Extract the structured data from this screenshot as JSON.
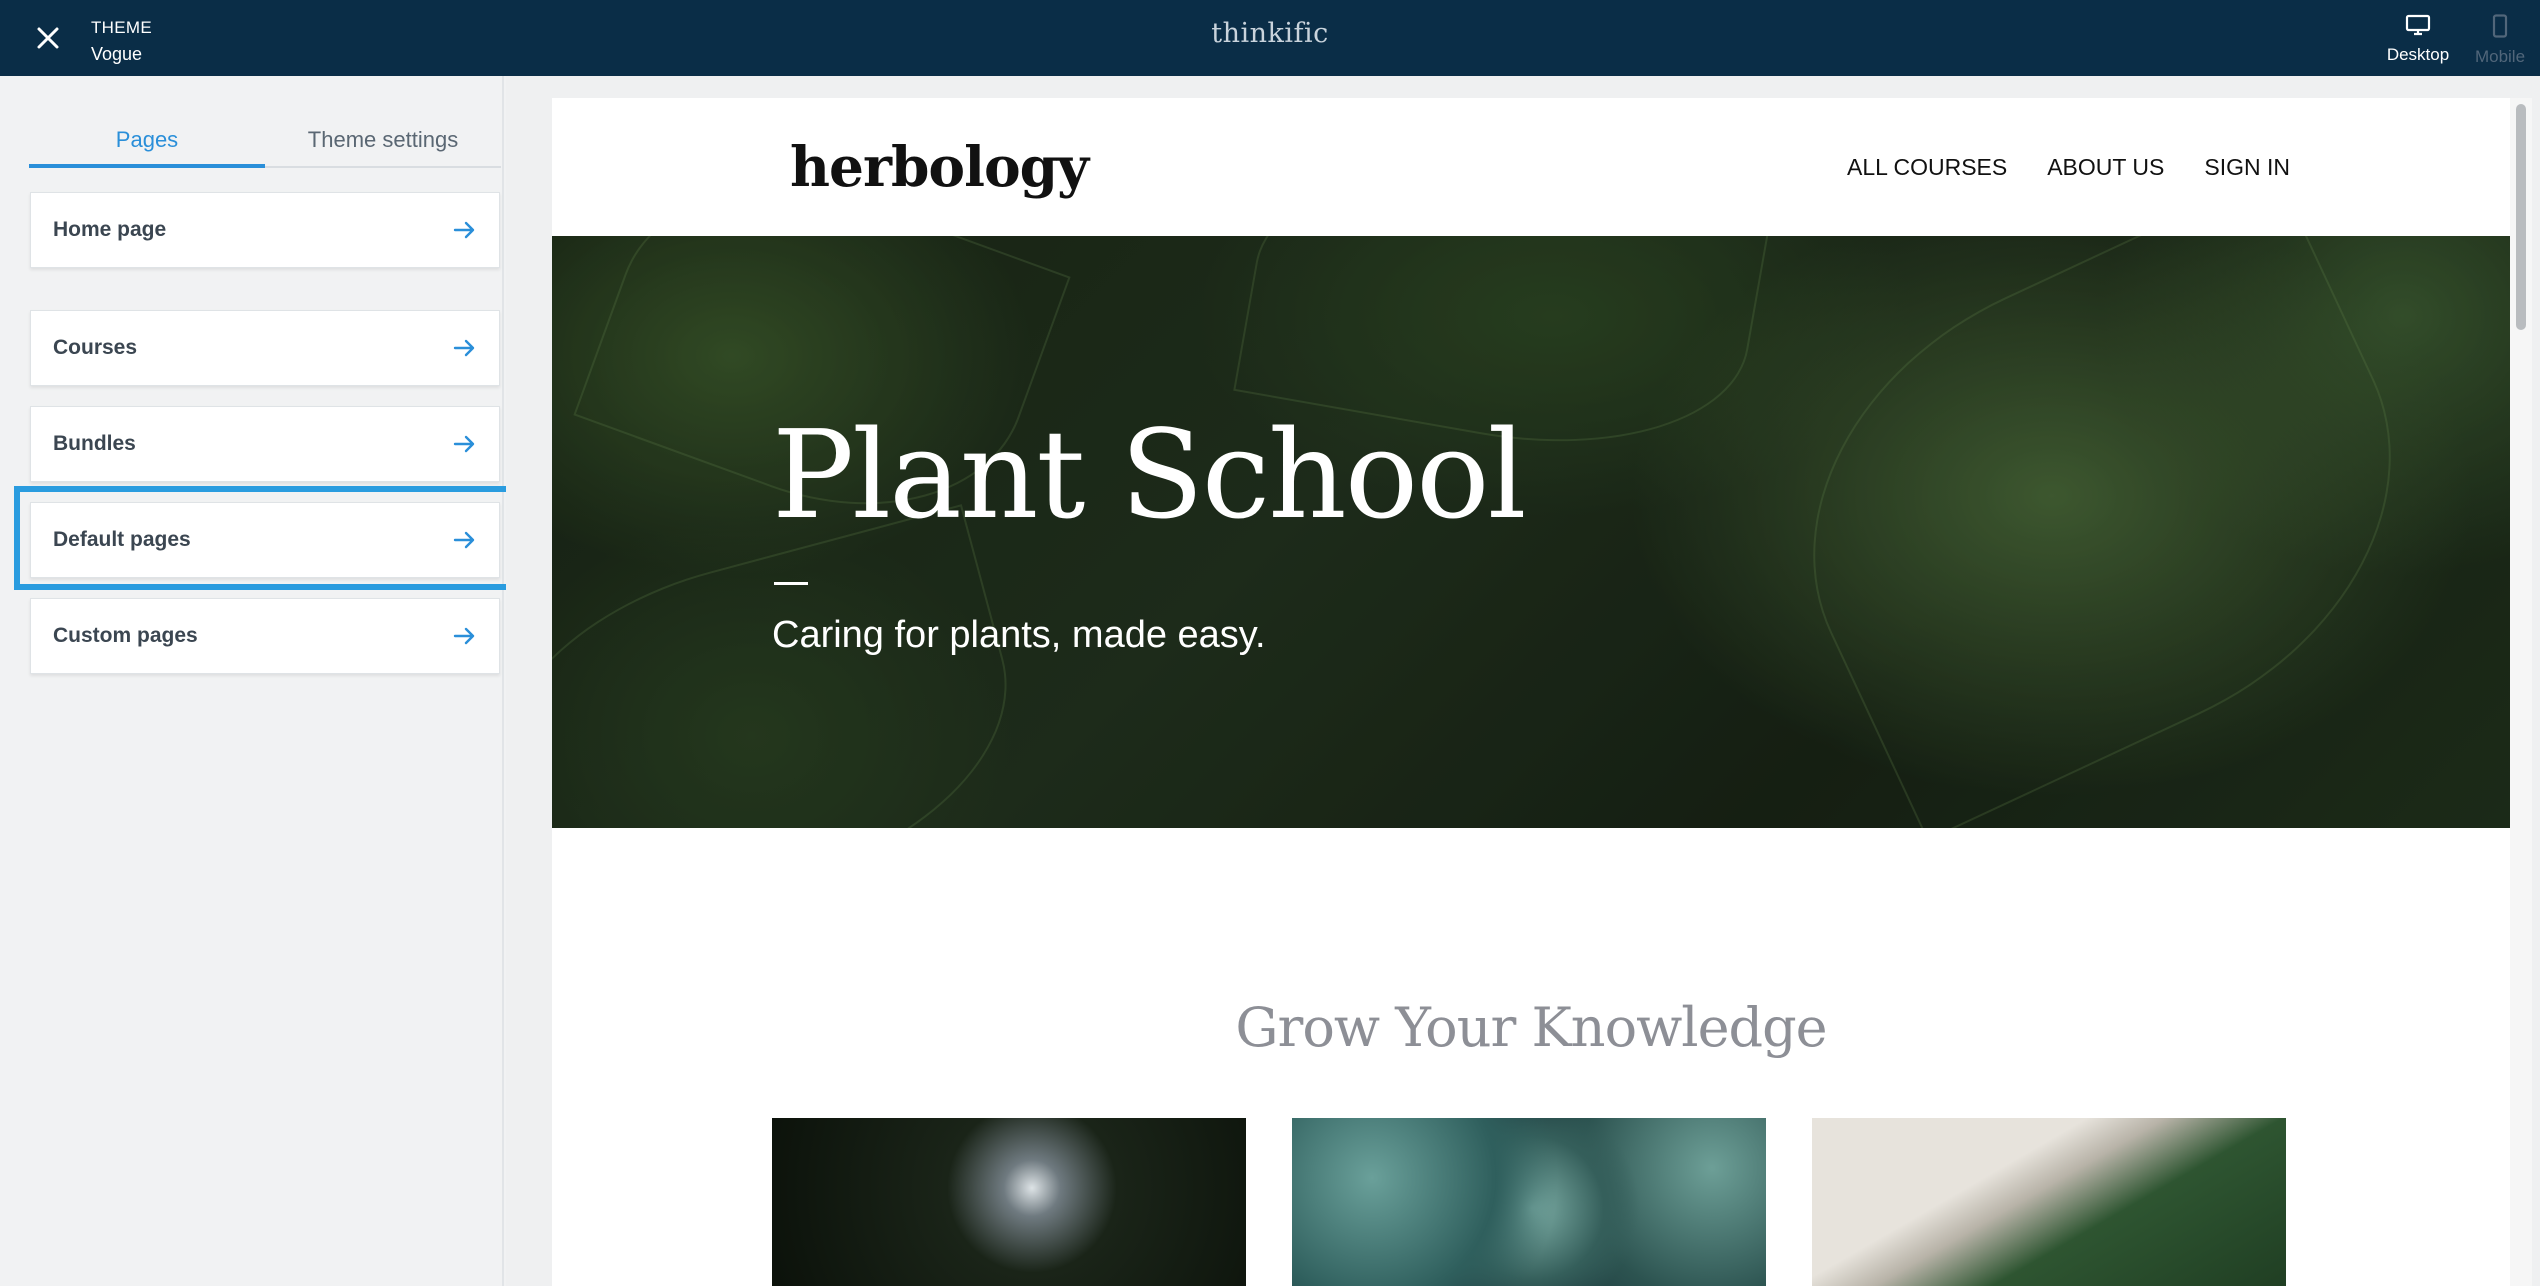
{
  "topbar": {
    "theme_caption": "THEME",
    "theme_name": "Vogue",
    "brand": "thinkific",
    "devices": [
      {
        "label": "Desktop",
        "icon": "desktop-icon",
        "active": true
      },
      {
        "label": "Mobile",
        "icon": "mobile-icon",
        "active": false
      }
    ]
  },
  "sidebar": {
    "tabs": [
      {
        "label": "Pages",
        "active": true
      },
      {
        "label": "Theme settings",
        "active": false
      }
    ],
    "items": [
      {
        "label": "Home page"
      },
      {
        "label": "Courses"
      },
      {
        "label": "Bundles"
      },
      {
        "label": "Default pages",
        "highlighted": true
      },
      {
        "label": "Custom pages"
      }
    ]
  },
  "preview": {
    "logo": "herbology",
    "nav": [
      "ALL COURSES",
      "ABOUT US",
      "SIGN IN"
    ],
    "hero_title": "Plant School",
    "hero_subtitle": "Caring for plants, made easy.",
    "section_title": "Grow Your Knowledge"
  },
  "colors": {
    "topbar_bg": "#0a2d47",
    "accent": "#2a8fd9",
    "highlight_border": "#2a9cdf"
  }
}
